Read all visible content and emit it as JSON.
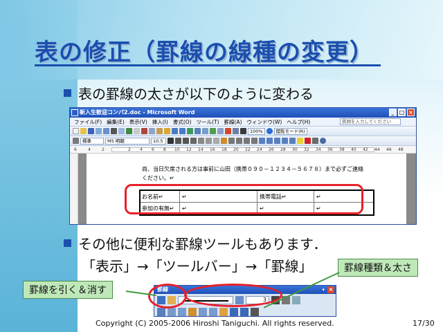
{
  "slide": {
    "title": "表の修正（罫線の線種の変更）",
    "bullet1": "表の罫線の太さが以下のように変わる",
    "bullet2": "その他に便利な罫線ツールもあります．",
    "bullet2_sub": "「表示」→「ツールバー」→「罫線」",
    "callout_right": "罫線種類＆太さ",
    "callout_left": "罫線を引く＆消す",
    "footer": "Copyright (C) 2005-2006 Hiroshi Taniguchi. All rights reserved.",
    "page_number": "17/30"
  },
  "word": {
    "title": "新入生歓迎コンパ2.doc - Microsoft Word",
    "menu": [
      "ファイル(F)",
      "編集(E)",
      "表示(V)",
      "挿入(I)",
      "書式(O)",
      "ツール(T)",
      "罫線(A)",
      "ウィンドウ(W)",
      "ヘルプ(H)"
    ],
    "help_placeholder": "質問を入力してください",
    "zoom": "100%",
    "view_mode": "閲覧モード(R)",
    "style": "標準",
    "font": "MS 明朝",
    "font_size": "10.5",
    "ruler_numbers": [
      "6",
      "4",
      "2",
      "2",
      "4",
      "6",
      "8",
      "10",
      "12",
      "14",
      "16",
      "18",
      "20",
      "22",
      "24",
      "26",
      "28",
      "30",
      "32",
      "34",
      "36",
      "38",
      "40",
      "42",
      "44",
      "46",
      "48"
    ],
    "doc_line1": "尚、当日欠席される方は事前に山田（携帯０９０－１２３４－５６７８）まで必ずご連絡",
    "doc_line2": "ください。↵",
    "table": {
      "r1c1": "お名前↵",
      "r1c2": "↵",
      "r1c3": "携帯電話↵",
      "r1c4": "↵",
      "r2c1": "参加の有無↵",
      "r2c2": "↵",
      "r2c3": "↵",
      "r2c4": "↵"
    }
  },
  "borders_toolbar": {
    "title": "罫線",
    "line_width": "3"
  },
  "colors": {
    "title_blue": "#1a4fae",
    "highlight_red": "#e8202a",
    "callout_green": "#bfe8b8"
  }
}
